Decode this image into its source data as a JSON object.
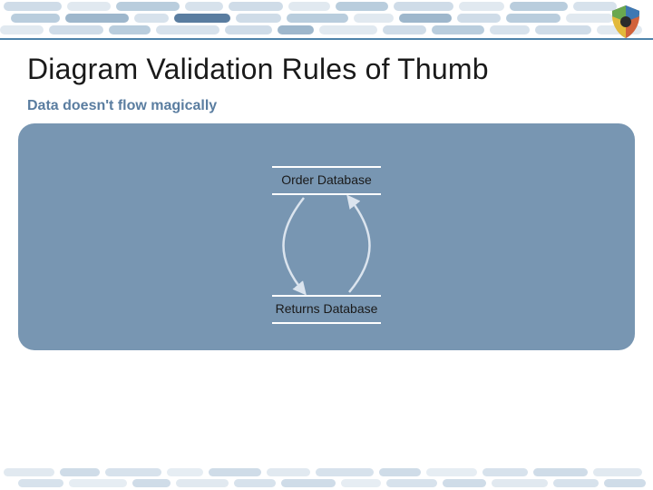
{
  "slide": {
    "title": "Diagram Validation Rules of Thumb",
    "subtitle": "Data doesn't flow magically"
  },
  "diagram": {
    "top_node": "Order Database",
    "bottom_node": "Returns Database"
  },
  "colors": {
    "accent_line": "#4e83aa",
    "panel_bg": "#7896b2",
    "pill_light": "#cfdce8",
    "pill_mid": "#9eb7cc",
    "pill_dark": "#5a7da0"
  }
}
